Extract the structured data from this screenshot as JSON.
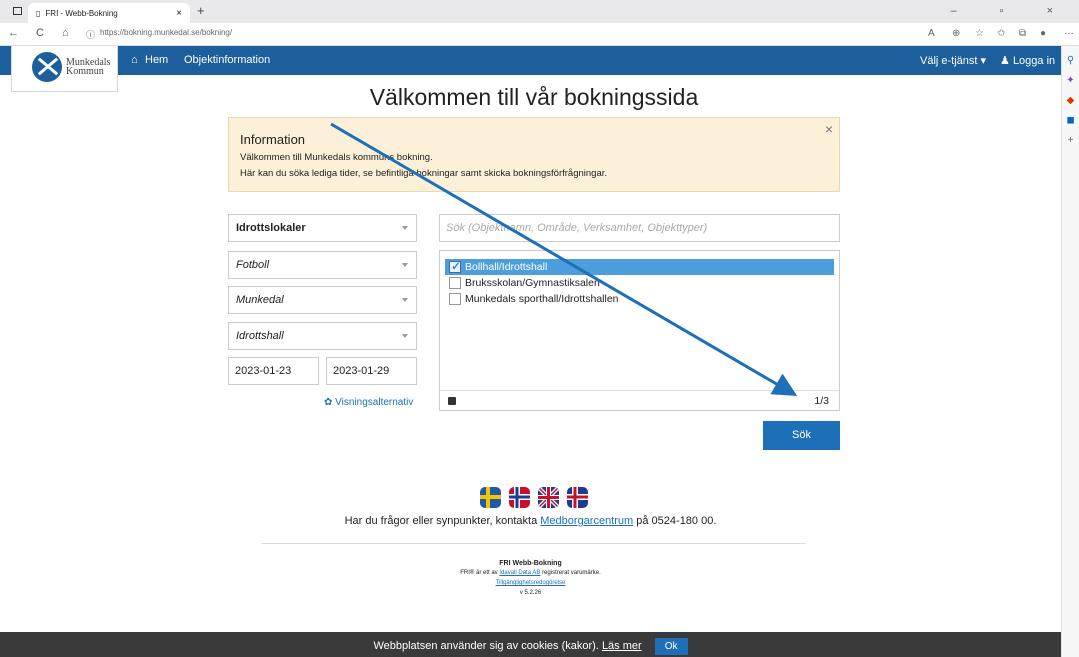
{
  "browser": {
    "tab_title": "FRI - Webb-Bokning",
    "tab_close": "×",
    "new_tab": "+",
    "window_controls": "– ▫ ×",
    "url": "https://bokning.munkedal.se/bokning/",
    "nav": {
      "back": "←",
      "reload": "C",
      "home": "⌂",
      "info": "ⓘ"
    },
    "more": "···"
  },
  "logo": {
    "line1": "Munkedals",
    "line2": "Kommun"
  },
  "navbar": {
    "home_label": "Hem",
    "object_info_label": "Objektinformation",
    "service_label": "Välj e-tjänst",
    "login_label": "Logga in",
    "home_icon": "⌂"
  },
  "page_title": "Välkommen till vår bokningssida",
  "info": {
    "title": "Information",
    "line1": "Välkommen till Munkedals kommuns bokning.",
    "line2": "Här kan du söka lediga tider, se befintliga bokningar samt skicka bokningsförfrågningar.",
    "close": "×"
  },
  "filters": {
    "category": "Idrottslokaler",
    "activity": "Fotboll",
    "area": "Munkedal",
    "object_type": "Idrottshall",
    "date_from": "2023-01-23",
    "date_to": "2023-01-29",
    "view_options_label": "Visningsalternativ",
    "view_options_icon": "✿"
  },
  "search": {
    "placeholder": "Sök (Objektnamn, Område, Verksamhet, Objekttyper)"
  },
  "objects": [
    {
      "label": "Bollhall/Idrottshall",
      "checked": true
    },
    {
      "label": "Bruksskolan/Gymnastiksalen",
      "checked": false
    },
    {
      "label": "Munkedals sporthall/Idrottshallen",
      "checked": false
    }
  ],
  "list_count": "1/3",
  "search_button": "Sök",
  "contact": {
    "prefix": "Har du frågor eller synpunkter, kontakta",
    "link": "Medborgarcentrum",
    "suffix": "på 0524-180 00."
  },
  "footer": {
    "product": "FRI Webb-Bokning",
    "trademark_prefix": "FRI® är ett av",
    "trademark_link": "Idavall Data AB",
    "trademark_suffix": "registrerat varumärke.",
    "accessibility": "Tillgänglighetsredogörelse",
    "version": "v 5.2.26"
  },
  "cookie": {
    "text": "Webbplatsen använder sig av cookies (kakor).",
    "more_link": "Läs mer",
    "ok": "Ok"
  },
  "colors": {
    "brand": "#1d5f9d",
    "button": "#1d6fb8",
    "info_bg": "#fcf0d9",
    "arrow": "#1d6fb8"
  }
}
